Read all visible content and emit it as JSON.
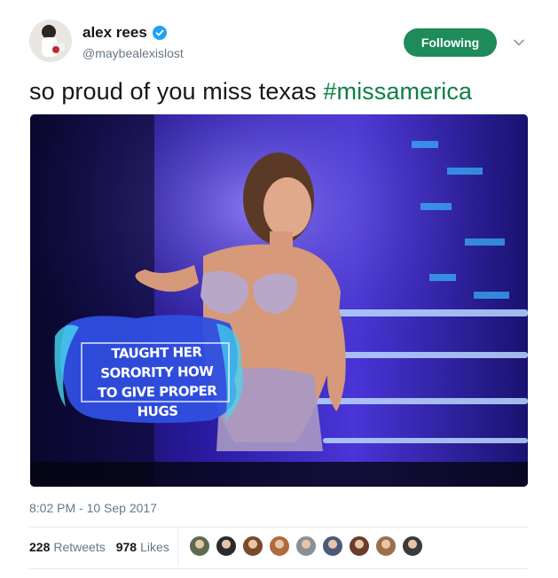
{
  "user": {
    "name": "alex rees",
    "handle": "@maybealexislost",
    "verified": true
  },
  "follow_button": {
    "label": "Following",
    "color": "#1e8b5a"
  },
  "tweet": {
    "text": "so proud of you miss texas ",
    "hashtag": "#missamerica",
    "hashtag_color": "#0d8045"
  },
  "media": {
    "caption_lines": [
      "TAUGHT HER",
      "SORORITY HOW",
      "TO GIVE PROPER HUGS"
    ]
  },
  "timestamp": "8:02 PM - 10 Sep 2017",
  "stats": {
    "retweets_count": "228",
    "retweets_label": "Retweets",
    "likes_count": "978",
    "likes_label": "Likes"
  },
  "likers": [
    {
      "icon": "liker-avatar",
      "color": "#5a6b4e"
    },
    {
      "icon": "liker-avatar",
      "color": "#2b2b2b"
    },
    {
      "icon": "liker-avatar",
      "color": "#7a4a2a"
    },
    {
      "icon": "liker-avatar",
      "color": "#b06a3c"
    },
    {
      "icon": "liker-avatar",
      "color": "#8a9096"
    },
    {
      "icon": "liker-avatar",
      "color": "#4a5a78"
    },
    {
      "icon": "liker-avatar",
      "color": "#6b3b2b"
    },
    {
      "icon": "liker-avatar",
      "color": "#9c6f4a"
    },
    {
      "icon": "liker-avatar",
      "color": "#3a3a3a"
    }
  ]
}
